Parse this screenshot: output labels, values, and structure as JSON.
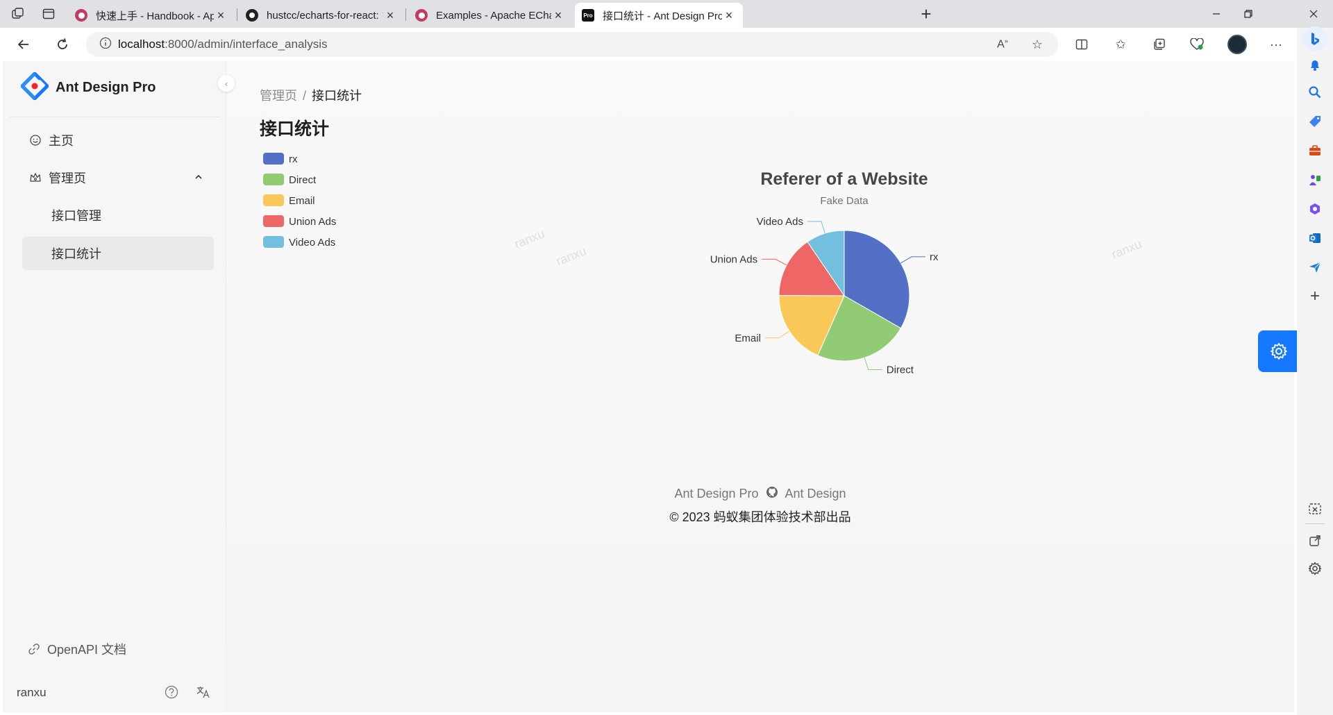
{
  "browser": {
    "tabs": [
      {
        "title": "快速上手 - Handbook - Apache E",
        "favicon": "echarts-handbook-icon"
      },
      {
        "title": "hustcc/echarts-for-react: 🐍 Apa",
        "favicon": "github-icon"
      },
      {
        "title": "Examples - Apache ECharts",
        "favicon": "echarts-icon"
      },
      {
        "title": "接口统计 - Ant Design Pro",
        "favicon": "pro-icon",
        "active": true
      }
    ],
    "url_host": "localhost",
    "url_path": ":8000/admin/interface_analysis",
    "colors": {
      "tabstrip": "#dfe1e5",
      "active_tab": "#ffffff"
    }
  },
  "app": {
    "logo_text": "Ant Design Pro",
    "menu": [
      {
        "label": "主页",
        "icon": "smile-icon"
      },
      {
        "label": "管理页",
        "icon": "crown-icon",
        "expanded": true,
        "children": [
          {
            "label": "接口管理"
          },
          {
            "label": "接口统计",
            "selected": true
          }
        ]
      }
    ],
    "openapi_link": "OpenAPI 文档",
    "username": "ranxu",
    "breadcrumb": [
      "管理页",
      "接口统计"
    ],
    "page_title": "接口统计",
    "watermark": "ranxu",
    "footer": {
      "link1": "Ant Design Pro",
      "link2": "Ant Design",
      "copyright": "2023 蚂蚁集团体验技术部出品"
    },
    "colors": {
      "primary": "#1677ff"
    }
  },
  "chart_data": {
    "type": "pie",
    "title": "Referer of a Website",
    "subtitle": "Fake Data",
    "legend_position": "top-left",
    "legend_orient": "vertical",
    "series": [
      {
        "name": "rx",
        "value": 1048,
        "color": "#5470c6"
      },
      {
        "name": "Direct",
        "value": 735,
        "color": "#91cc75"
      },
      {
        "name": "Email",
        "value": 580,
        "color": "#fac858"
      },
      {
        "name": "Union Ads",
        "value": 484,
        "color": "#ee6666"
      },
      {
        "name": "Video Ads",
        "value": 300,
        "color": "#73c0de"
      }
    ]
  }
}
